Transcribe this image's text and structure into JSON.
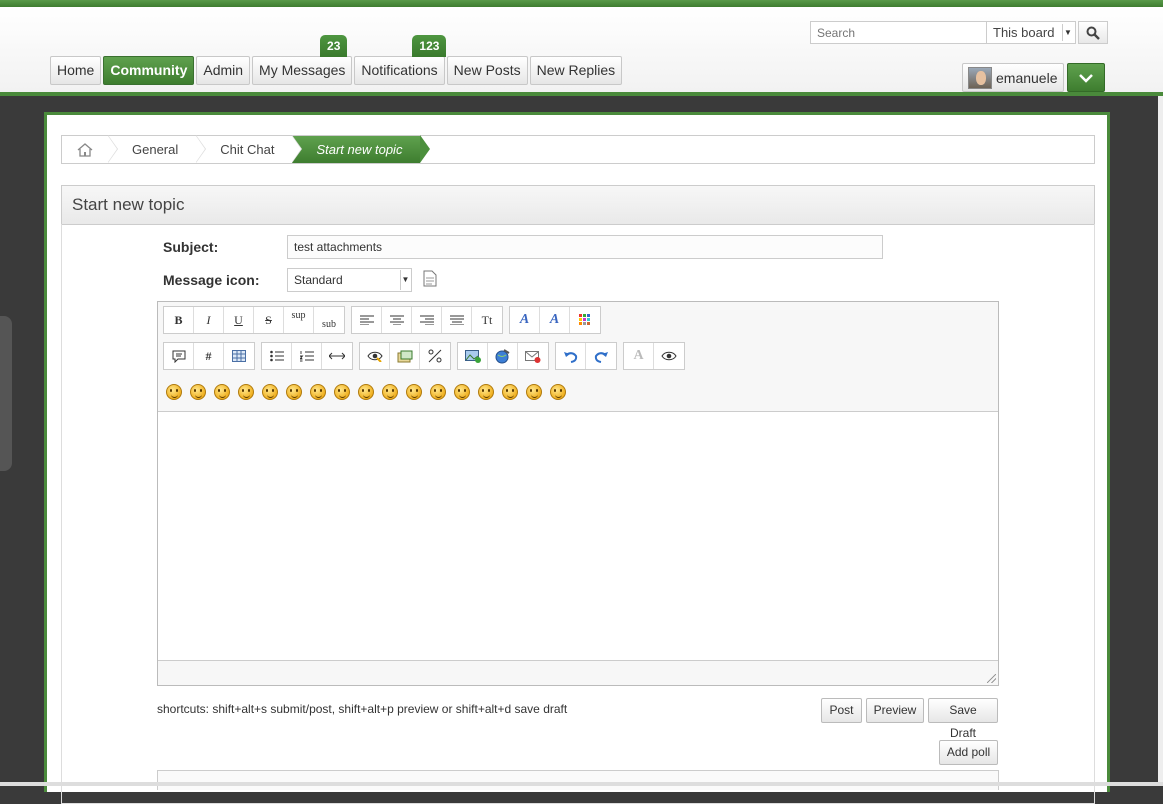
{
  "header": {
    "search": {
      "placeholder": "Search",
      "scope": "This board"
    },
    "nav": [
      {
        "label": "Home"
      },
      {
        "label": "Community"
      },
      {
        "label": "Admin"
      },
      {
        "label": "My Messages",
        "badge": "23"
      },
      {
        "label": "Notifications",
        "badge": "123"
      },
      {
        "label": "New Posts"
      },
      {
        "label": "New Replies"
      }
    ],
    "user": {
      "name": "emanuele"
    }
  },
  "breadcrumb": {
    "items": [
      "General",
      "Chit Chat"
    ],
    "current": "Start new topic"
  },
  "form": {
    "title": "Start new topic",
    "subject_label": "Subject:",
    "subject_value": "test attachments",
    "icon_label": "Message icon:",
    "icon_value": "Standard",
    "toolbar_row1": [
      "B",
      "I",
      "U",
      "S",
      "sup",
      "sub",
      "align-left",
      "align-center",
      "align-right",
      "justify",
      "Tt",
      "font-face",
      "font-size",
      "font-color"
    ],
    "toolbar_row2": [
      "quote",
      "#",
      "table",
      "bullet-list",
      "numbered-list",
      "hr",
      "spoiler",
      "image-insert",
      "percent"
    ],
    "shortcuts": "shortcuts: shift+alt+s submit/post, shift+alt+p preview or shift+alt+d save draft",
    "post_label": "Post",
    "preview_label": "Preview",
    "draft_label": "Save Draft",
    "poll_label": "Add poll"
  },
  "colors": {
    "accent": "#4a8a3b",
    "accent_light": "#5fa14e"
  }
}
